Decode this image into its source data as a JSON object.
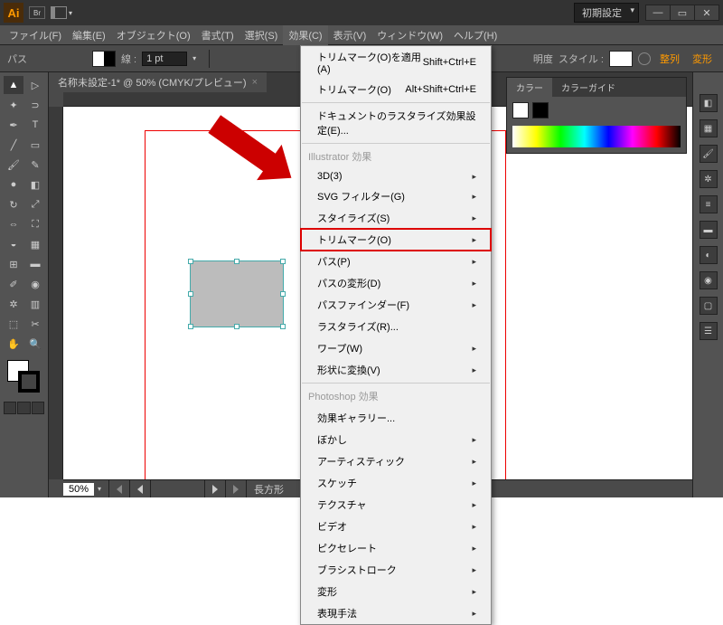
{
  "titlebar": {
    "logo": "Ai",
    "br": "Br",
    "workspace": "初期設定"
  },
  "menus": [
    "ファイル(F)",
    "編集(E)",
    "オブジェクト(O)",
    "書式(T)",
    "選択(S)",
    "効果(C)",
    "表示(V)",
    "ウィンドウ(W)",
    "ヘルプ(H)"
  ],
  "ctrl": {
    "path": "パス",
    "stroke_lbl": "線 :",
    "stroke_val": "1 pt",
    "opacity_lbl": "明度",
    "style_lbl": "スタイル :",
    "align": "整列",
    "transform": "変形"
  },
  "tab": {
    "title": "名称未設定-1* @ 50% (CMYK/プレビュー)",
    "close": "×"
  },
  "dropdown": {
    "apply": {
      "label": "トリムマーク(O)を適用(A)",
      "sc": "Shift+Ctrl+E"
    },
    "last": {
      "label": "トリムマーク(O)",
      "sc": "Alt+Shift+Ctrl+E"
    },
    "rasterize": "ドキュメントのラスタライズ効果設定(E)...",
    "hdr_ill": "Illustrator 効果",
    "ill": [
      {
        "l": "3D(3)"
      },
      {
        "l": "SVG フィルター(G)"
      },
      {
        "l": "スタイライズ(S)"
      },
      {
        "l": "トリムマーク(O)",
        "hi": true
      },
      {
        "l": "パス(P)"
      },
      {
        "l": "パスの変形(D)"
      },
      {
        "l": "パスファインダー(F)"
      },
      {
        "l": "ラスタライズ(R)..."
      },
      {
        "l": "ワープ(W)"
      },
      {
        "l": "形状に変換(V)"
      }
    ],
    "hdr_ps": "Photoshop 効果",
    "ps": [
      "効果ギャラリー...",
      "ぼかし",
      "アーティスティック",
      "スケッチ",
      "テクスチャ",
      "ビデオ",
      "ピクセレート",
      "ブラシストローク",
      "変形",
      "表現手法"
    ]
  },
  "status": {
    "zoom": "50%",
    "shape": "長方形"
  },
  "colorpanel": {
    "t1": "カラー",
    "t2": "カラーガイド"
  }
}
